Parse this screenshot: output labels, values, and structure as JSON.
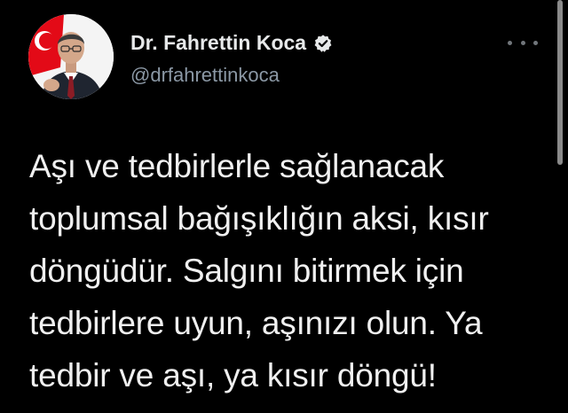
{
  "tweet": {
    "author": {
      "display_name": "Dr. Fahrettin Koca",
      "handle": "@drfahrettinkoca",
      "verified_icon": "verified-badge-icon",
      "avatar_icon": "profile-photo"
    },
    "more_icon": "more-options-icon",
    "text_lines": [
      "Aşı ve tedbirlerle sağlanacak",
      "toplumsal bağışıklığın aksi, kısır",
      "döngüdür. Salgını bitirmek için",
      "tedbirlere uyun, aşınızı olun. Ya",
      "tedbir ve aşı, ya kısır döngü!"
    ]
  },
  "colors": {
    "background": "#000000",
    "name": "#e7e9ea",
    "handle": "#8b98a5",
    "accent_flag": "#e30a17"
  }
}
